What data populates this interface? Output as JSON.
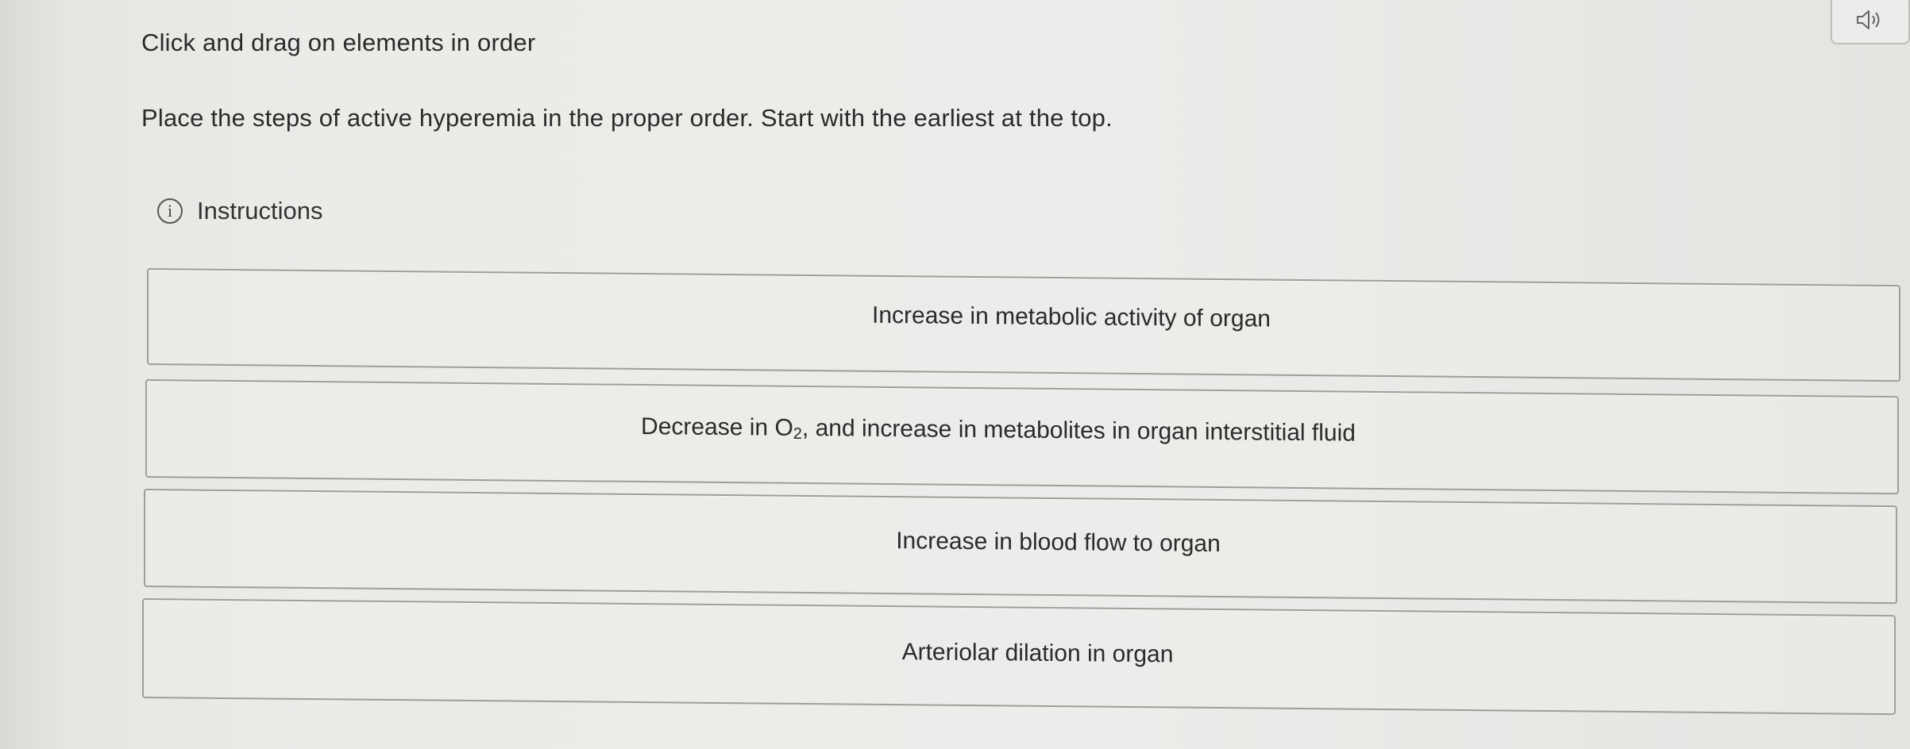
{
  "prompt": {
    "title": "Click and drag on elements in order",
    "question": "Place the steps of active hyperemia in the proper order. Start with the earliest at the top."
  },
  "instructions": {
    "icon": "info-icon",
    "icon_glyph": "i",
    "label": "Instructions"
  },
  "audio": {
    "icon": "speaker-icon"
  },
  "drag_items": [
    {
      "text": "Increase in metabolic activity of organ"
    },
    {
      "text_before": "Decrease in O",
      "subscript": "2",
      "text_after": ", and increase in metabolites in organ interstitial fluid"
    },
    {
      "text": "Increase in blood flow to organ"
    },
    {
      "text": "Arteriolar dilation in organ"
    }
  ]
}
